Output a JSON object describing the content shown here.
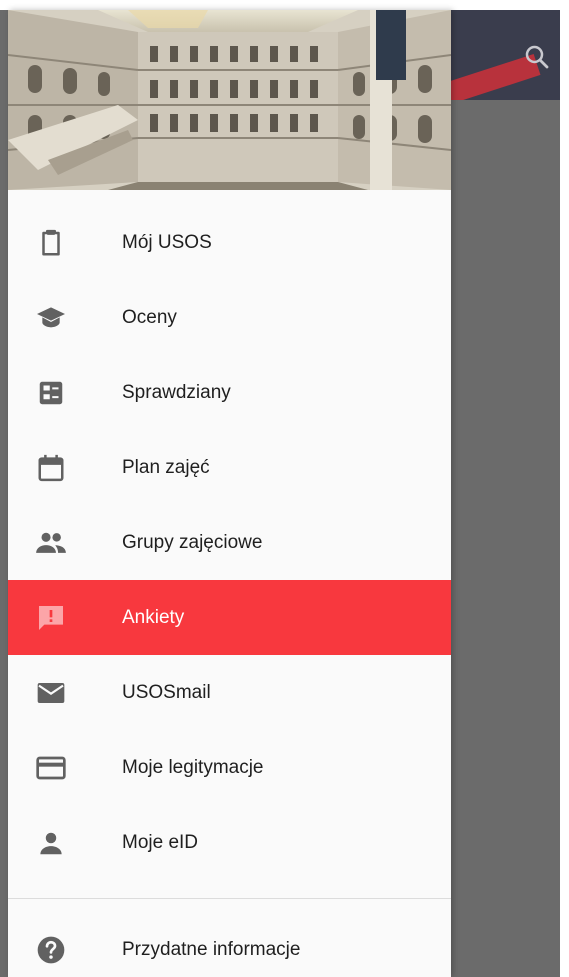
{
  "drawer": {
    "items": [
      {
        "label": "Mój USOS",
        "icon": "clipboard-icon"
      },
      {
        "label": "Oceny",
        "icon": "graduation-cap-icon"
      },
      {
        "label": "Sprawdziany",
        "icon": "checklist-icon"
      },
      {
        "label": "Plan zajęć",
        "icon": "calendar-icon"
      },
      {
        "label": "Grupy zajęciowe",
        "icon": "people-icon"
      },
      {
        "label": "Ankiety",
        "icon": "feedback-icon",
        "active": true
      },
      {
        "label": "USOSmail",
        "icon": "mail-icon"
      },
      {
        "label": "Moje legitymacje",
        "icon": "card-icon"
      },
      {
        "label": "Moje eID",
        "icon": "person-icon"
      }
    ],
    "footer_items": [
      {
        "label": "Przydatne informacje",
        "icon": "help-icon"
      }
    ]
  },
  "colors": {
    "active_bg": "#f8383e",
    "icon_gray": "#616161",
    "scrim": "#6b6b6b"
  }
}
